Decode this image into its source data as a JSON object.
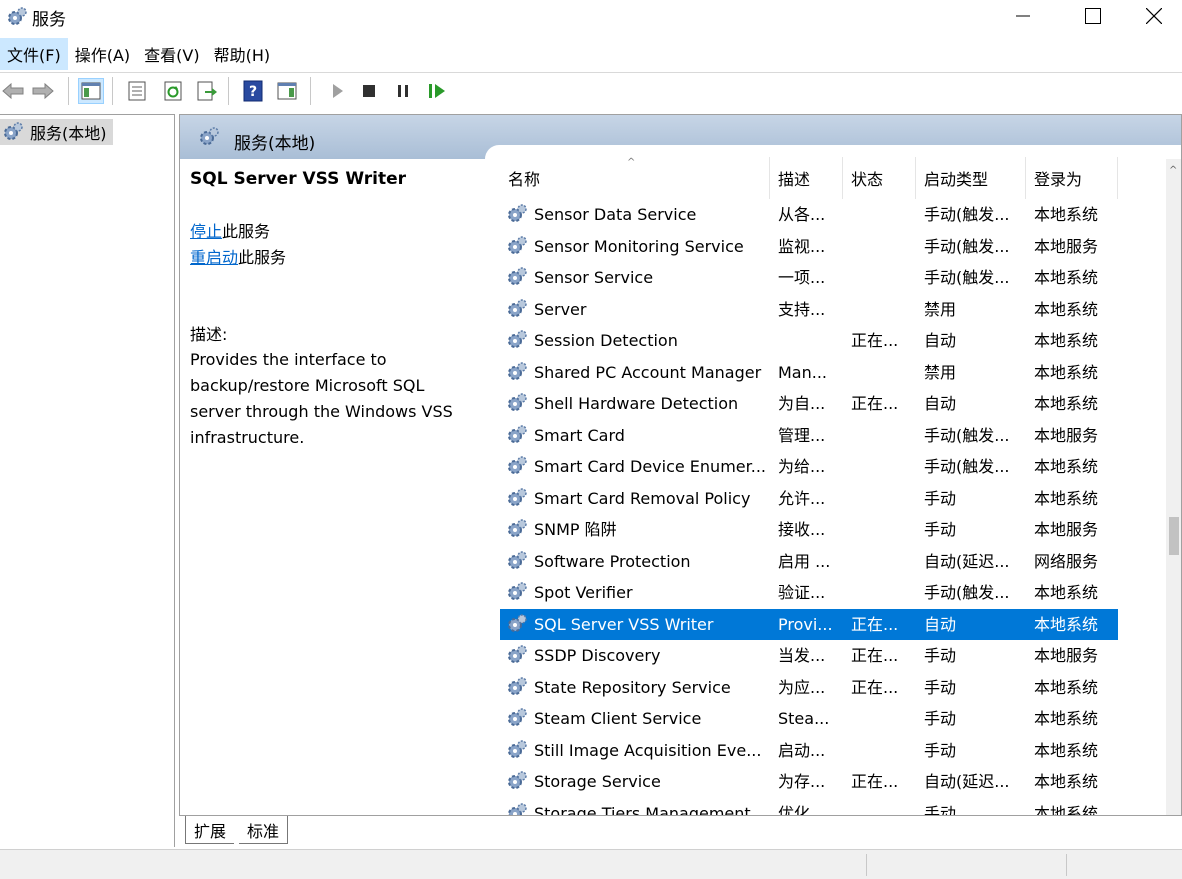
{
  "window": {
    "title": "服务"
  },
  "menu": [
    {
      "label": "文件(F)"
    },
    {
      "label": "操作(A)"
    },
    {
      "label": "查看(V)"
    },
    {
      "label": "帮助(H)"
    }
  ],
  "tree": {
    "root": "服务(本地)"
  },
  "pane": {
    "header": "服务(本地)"
  },
  "detail": {
    "title": "SQL Server VSS Writer",
    "stop_link": "停止",
    "stop_suffix": "此服务",
    "restart_link": "重启动",
    "restart_suffix": "此服务",
    "desc_label": "描述:",
    "desc_lines": [
      "Provides the interface to",
      "backup/restore Microsoft SQL",
      "server through the Windows VSS",
      "infrastructure."
    ]
  },
  "columns": [
    "名称",
    "描述",
    "状态",
    "启动类型",
    "登录为"
  ],
  "services": [
    {
      "name": "Sensor Data Service",
      "desc": "从各...",
      "status": "",
      "startup": "手动(触发...",
      "logon": "本地系统"
    },
    {
      "name": "Sensor Monitoring Service",
      "desc": "监视...",
      "status": "",
      "startup": "手动(触发...",
      "logon": "本地服务"
    },
    {
      "name": "Sensor Service",
      "desc": "一项...",
      "status": "",
      "startup": "手动(触发...",
      "logon": "本地系统"
    },
    {
      "name": "Server",
      "desc": "支持...",
      "status": "",
      "startup": "禁用",
      "logon": "本地系统"
    },
    {
      "name": "Session Detection",
      "desc": "",
      "status": "正在...",
      "startup": "自动",
      "logon": "本地系统"
    },
    {
      "name": "Shared PC Account Manager",
      "desc": "Man...",
      "status": "",
      "startup": "禁用",
      "logon": "本地系统"
    },
    {
      "name": "Shell Hardware Detection",
      "desc": "为自...",
      "status": "正在...",
      "startup": "自动",
      "logon": "本地系统"
    },
    {
      "name": "Smart Card",
      "desc": "管理...",
      "status": "",
      "startup": "手动(触发...",
      "logon": "本地服务"
    },
    {
      "name": "Smart Card Device Enumer...",
      "desc": "为给...",
      "status": "",
      "startup": "手动(触发...",
      "logon": "本地系统"
    },
    {
      "name": "Smart Card Removal Policy",
      "desc": "允许...",
      "status": "",
      "startup": "手动",
      "logon": "本地系统"
    },
    {
      "name": "SNMP 陷阱",
      "desc": "接收...",
      "status": "",
      "startup": "手动",
      "logon": "本地服务"
    },
    {
      "name": "Software Protection",
      "desc": "启用 ...",
      "status": "",
      "startup": "自动(延迟...",
      "logon": "网络服务"
    },
    {
      "name": "Spot Verifier",
      "desc": "验证...",
      "status": "",
      "startup": "手动(触发...",
      "logon": "本地系统"
    },
    {
      "name": "SQL Server VSS Writer",
      "desc": "Provi...",
      "status": "正在...",
      "startup": "自动",
      "logon": "本地系统",
      "selected": true
    },
    {
      "name": "SSDP Discovery",
      "desc": "当发...",
      "status": "正在...",
      "startup": "手动",
      "logon": "本地服务"
    },
    {
      "name": "State Repository Service",
      "desc": "为应...",
      "status": "正在...",
      "startup": "手动",
      "logon": "本地系统"
    },
    {
      "name": "Steam Client Service",
      "desc": "Stea...",
      "status": "",
      "startup": "手动",
      "logon": "本地系统"
    },
    {
      "name": "Still Image Acquisition Eve...",
      "desc": "启动...",
      "status": "",
      "startup": "手动",
      "logon": "本地系统"
    },
    {
      "name": "Storage Service",
      "desc": "为存...",
      "status": "正在...",
      "startup": "自动(延迟...",
      "logon": "本地系统"
    },
    {
      "name": "Storage Tiers Management",
      "desc": "优化...",
      "status": "",
      "startup": "手动",
      "logon": "本地系统"
    }
  ],
  "tabs": [
    {
      "label": "扩展"
    },
    {
      "label": "标准"
    }
  ],
  "colors": {
    "selection": "#0078d7",
    "link": "#0066cc",
    "header_gradient": "#b4c6dc"
  }
}
